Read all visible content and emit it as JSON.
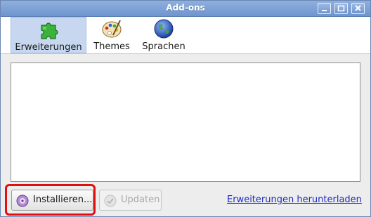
{
  "window": {
    "title": "Add-ons"
  },
  "tabs": [
    {
      "label": "Erweiterungen",
      "icon": "puzzle-icon",
      "selected": true
    },
    {
      "label": "Themes",
      "icon": "palette-icon",
      "selected": false
    },
    {
      "label": "Sprachen",
      "icon": "globe-icon",
      "selected": false
    }
  ],
  "buttons": {
    "install_label": "Installieren...",
    "update_label": "Updaten"
  },
  "links": {
    "download_label": "Erweiterungen herunterladen"
  },
  "colors": {
    "titlebar": "#7b9fd4",
    "selected_tab": "#c6d7ef",
    "highlight": "#e01010",
    "link": "#1a2cc4"
  }
}
